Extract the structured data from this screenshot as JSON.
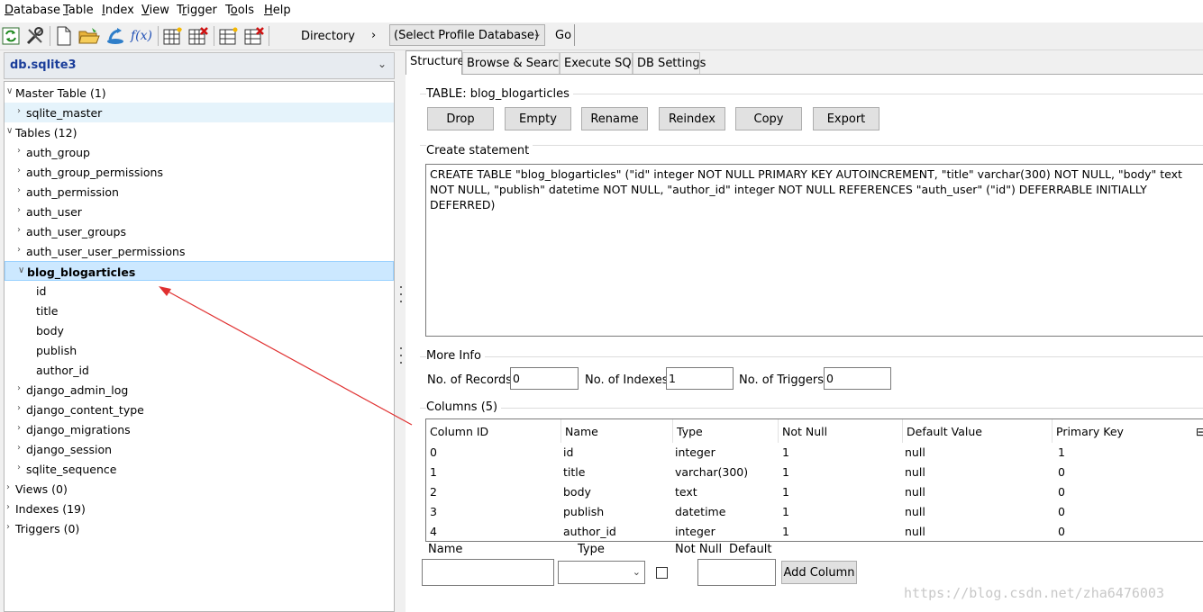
{
  "menu": [
    {
      "label": "Database",
      "accel": "D"
    },
    {
      "label": "Table",
      "accel": "T"
    },
    {
      "label": "Index",
      "accel": "I"
    },
    {
      "label": "View",
      "accel": "V"
    },
    {
      "label": "Trigger",
      "accel": "r"
    },
    {
      "label": "Tools",
      "accel": "o"
    },
    {
      "label": "Help",
      "accel": "H"
    }
  ],
  "toolbar": {
    "icons": [
      "refresh-icon",
      "tools-icon",
      "new-file-icon",
      "open-folder-icon",
      "connect-icon",
      "function-icon",
      "new-table-icon",
      "drop-table-icon",
      "new-index-icon",
      "drop-index-icon"
    ],
    "function_label": "f(x)",
    "directory_label": "Directory",
    "directory_arrow": "›",
    "profile_select": "(Select Profile Database)",
    "go_label": "Go"
  },
  "database": {
    "name": "db.sqlite3"
  },
  "tree": [
    {
      "label": "Master Table (1)",
      "level": 0,
      "state": "open"
    },
    {
      "label": "sqlite_master",
      "level": 1,
      "state": "closed",
      "hover": true
    },
    {
      "label": "Tables (12)",
      "level": 0,
      "state": "open"
    },
    {
      "label": "auth_group",
      "level": 1,
      "state": "closed"
    },
    {
      "label": "auth_group_permissions",
      "level": 1,
      "state": "closed"
    },
    {
      "label": "auth_permission",
      "level": 1,
      "state": "closed"
    },
    {
      "label": "auth_user",
      "level": 1,
      "state": "closed"
    },
    {
      "label": "auth_user_groups",
      "level": 1,
      "state": "closed"
    },
    {
      "label": "auth_user_user_permissions",
      "level": 1,
      "state": "closed"
    },
    {
      "label": "blog_blogarticles",
      "level": 1,
      "state": "open",
      "selected": true
    },
    {
      "label": "id",
      "level": 2,
      "state": "leaf"
    },
    {
      "label": "title",
      "level": 2,
      "state": "leaf"
    },
    {
      "label": "body",
      "level": 2,
      "state": "leaf"
    },
    {
      "label": "publish",
      "level": 2,
      "state": "leaf"
    },
    {
      "label": "author_id",
      "level": 2,
      "state": "leaf"
    },
    {
      "label": "django_admin_log",
      "level": 1,
      "state": "closed"
    },
    {
      "label": "django_content_type",
      "level": 1,
      "state": "closed"
    },
    {
      "label": "django_migrations",
      "level": 1,
      "state": "closed"
    },
    {
      "label": "django_session",
      "level": 1,
      "state": "closed"
    },
    {
      "label": "sqlite_sequence",
      "level": 1,
      "state": "closed"
    },
    {
      "label": "Views (0)",
      "level": 0,
      "state": "closed"
    },
    {
      "label": "Indexes (19)",
      "level": 0,
      "state": "closed"
    },
    {
      "label": "Triggers (0)",
      "level": 0,
      "state": "closed"
    }
  ],
  "tabs": [
    {
      "label": "Structure",
      "active": true
    },
    {
      "label": "Browse & Search",
      "active": false
    },
    {
      "label": "Execute SQL",
      "active": false
    },
    {
      "label": "DB Settings",
      "active": false
    }
  ],
  "structure": {
    "table_title": "TABLE: blog_blogarticles",
    "actions": [
      "Drop",
      "Empty",
      "Rename",
      "Reindex",
      "Copy",
      "Export"
    ],
    "create_title": "Create statement",
    "create_sql": "CREATE TABLE \"blog_blogarticles\" (\"id\" integer NOT NULL PRIMARY KEY AUTOINCREMENT, \"title\" varchar(300) NOT NULL, \"body\" text NOT NULL, \"publish\" datetime NOT NULL, \"author_id\" integer NOT NULL REFERENCES \"auth_user\" (\"id\") DEFERRABLE INITIALLY DEFERRED)",
    "more_info_title": "More Info",
    "records_label": "No. of Records:",
    "records": "0",
    "indexes_label": "No. of Indexes:",
    "indexes": "1",
    "triggers_label": "No. of Triggers:",
    "triggers": "0",
    "columns_title": "Columns (5)",
    "columns_headers": [
      "Column ID",
      "Name",
      "Type",
      "Not Null",
      "Default Value",
      "Primary Key"
    ],
    "columns_rows": [
      [
        "0",
        "id",
        "integer",
        "1",
        "null",
        "1"
      ],
      [
        "1",
        "title",
        "varchar(300)",
        "1",
        "null",
        "0"
      ],
      [
        "2",
        "body",
        "text",
        "1",
        "null",
        "0"
      ],
      [
        "3",
        "publish",
        "datetime",
        "1",
        "null",
        "0"
      ],
      [
        "4",
        "author_id",
        "integer",
        "1",
        "null",
        "0"
      ]
    ],
    "add_labels": {
      "name": "Name",
      "type": "Type",
      "not_null": "Not Null",
      "default": "Default"
    },
    "add_button": "Add Column"
  },
  "watermark": "https://blog.csdn.net/zha6476003",
  "annotation_color": "#e03030"
}
